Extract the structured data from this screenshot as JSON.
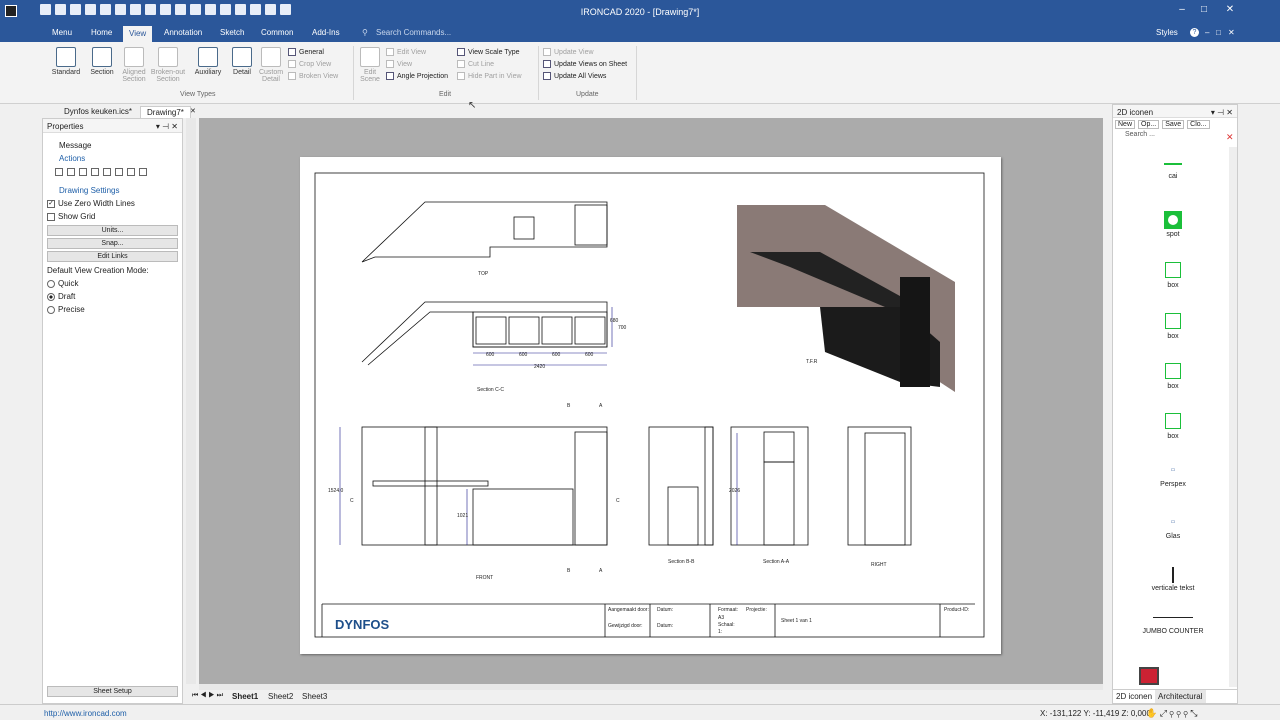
{
  "app": {
    "title": "IRONCAD 2020 - [Drawing7*]",
    "help": "?"
  },
  "menu": {
    "items": [
      "Menu",
      "Home",
      "View",
      "Annotation",
      "Sketch",
      "Common",
      "Add-Ins"
    ],
    "search": "Search Commands...",
    "styles": "Styles"
  },
  "ribbon": {
    "view_types": {
      "label": "View Types",
      "buttons": [
        "Standard",
        "Section",
        "Aligned Section",
        "Broken-out Section",
        "Auxiliary",
        "Detail",
        "Custom Detail"
      ],
      "small": [
        "General",
        "Crop View",
        "Broken View"
      ]
    },
    "edit": {
      "label": "Edit",
      "edit_scene": "Edit Scene",
      "small": [
        "Edit View",
        "View",
        "Angle Projection",
        "View Scale Type",
        "Cut Line",
        "Hide Part in View"
      ]
    },
    "update": {
      "label": "Update",
      "small": [
        "Update View",
        "Update Views on Sheet",
        "Update All Views"
      ]
    }
  },
  "doc_tabs": [
    "Dynfos keuken.ics*",
    "Drawing7*"
  ],
  "properties": {
    "title": "Properties",
    "message": "Message",
    "actions": "Actions",
    "drawing_settings": "Drawing Settings",
    "use_zero": "Use Zero Width Lines",
    "show_grid": "Show Grid",
    "units": "Units...",
    "snap": "Snap...",
    "edit_links": "Edit Links",
    "default_mode": "Default View Creation Mode:",
    "modes": [
      "Quick",
      "Draft",
      "Precise"
    ],
    "sheet_setup": "Sheet Setup"
  },
  "sheet_tabs": [
    "Sheet1",
    "Sheet2",
    "Sheet3"
  ],
  "drawing": {
    "views": [
      "TOP",
      "Section C-C",
      "T.F.R",
      "FRONT",
      "Section B-B",
      "Section A-A",
      "RIGHT"
    ],
    "dims": [
      "600",
      "600",
      "600",
      "600",
      "2420",
      "700",
      "680",
      "1524.0",
      "1021",
      "2026"
    ],
    "markers": [
      "B",
      "A",
      "C",
      "C",
      "B",
      "A"
    ],
    "logo": "DYNFOS",
    "title_block": [
      "Aangemaakt door:",
      "Gewijzigd door:",
      "Datum:",
      "Datum:",
      "Formaat:",
      "A3",
      "Schaal:",
      "1:",
      "Projectie:",
      "Sheet 1 van 1",
      "Product-ID:"
    ]
  },
  "panel2d": {
    "title": "2D iconen",
    "buttons": [
      "New",
      "Op...",
      "Save",
      "Clo..."
    ],
    "search": "Search ...",
    "items": [
      "cai",
      "spot",
      "box",
      "box",
      "box",
      "box",
      "Perspex",
      "Glas",
      "verticale tekst",
      "JUMBO COUNTER"
    ],
    "tabs": [
      "2D iconen",
      "Architectural"
    ]
  },
  "status": {
    "url": "http://www.ironcad.com",
    "coords": "X: -131,122 Y: -11,419 Z: 0,000"
  },
  "colors": {
    "titlebar": "#2b579a",
    "accent": "#1e5fa8",
    "icon_green": "#1bbf3a"
  }
}
